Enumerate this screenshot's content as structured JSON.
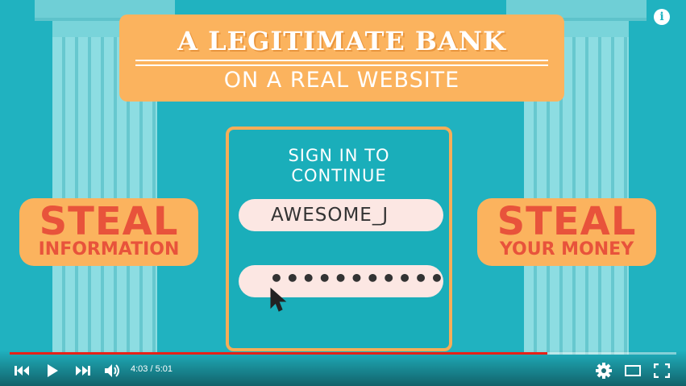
{
  "banner": {
    "title": "A LEGITIMATE BANK",
    "subtitle": "ON A REAL WEBSITE"
  },
  "left_badge": {
    "line1": "STEAL",
    "line2": "INFORMATION"
  },
  "right_badge": {
    "line1": "STEAL",
    "line2": "YOUR MONEY"
  },
  "login": {
    "heading_line1": "SIGN IN TO",
    "heading_line2": "CONTINUE",
    "username": "AWESOME_J",
    "password_mask": "•••••••••••"
  },
  "player": {
    "current_time": "4:03",
    "separator": " / ",
    "duration": "5:01",
    "progress_fraction": 0.807,
    "progress_color": "#e62117"
  },
  "icons": {
    "info": "i",
    "previous": "previous-icon",
    "play": "play-icon",
    "next": "next-icon",
    "volume": "volume-icon",
    "settings": "gear-icon",
    "theater": "theater-mode-icon",
    "fullscreen": "fullscreen-icon"
  },
  "colors": {
    "background": "#20b2c0",
    "banner": "#fbb35e",
    "badge_text": "#e8533b"
  }
}
